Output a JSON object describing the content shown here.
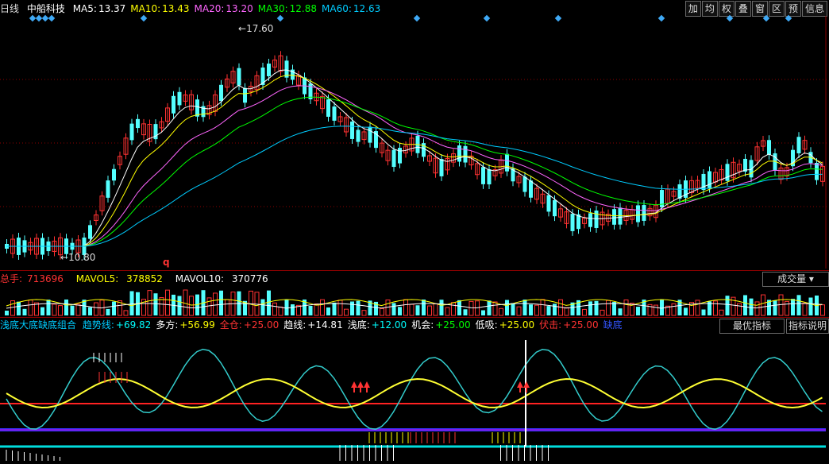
{
  "header": {
    "period": "日线",
    "stock_name": "中船科技",
    "ma": [
      {
        "label": "MA5:",
        "value": "13.37",
        "color": "#ffffff"
      },
      {
        "label": "MA10:",
        "value": "13.43",
        "color": "#ffff00"
      },
      {
        "label": "MA20:",
        "value": "13.20",
        "color": "#ff66ff"
      },
      {
        "label": "MA30:",
        "value": "12.88",
        "color": "#00ff00"
      },
      {
        "label": "MA60:",
        "value": "12.63",
        "color": "#00ccff"
      }
    ]
  },
  "toolbar": [
    "加",
    "均",
    "权",
    "叠",
    "窗",
    "区",
    "预",
    "信息"
  ],
  "price_chart": {
    "high_label": "17.60",
    "low_label": "10.80",
    "marker": "q"
  },
  "volume": {
    "total_label": "总手:",
    "total_value": "713696",
    "mavol5_label": "MAVOL5:",
    "mavol5_value": "378852",
    "mavol10_label": "MAVOL10:",
    "mavol10_value": "370776",
    "selector": "成交量"
  },
  "indicator": {
    "name": "浅底大底缺底组合",
    "items": [
      {
        "label": "趋势线:",
        "value": "+69.82",
        "color": "#00ffff"
      },
      {
        "label": "多方:",
        "value": "+56.99",
        "color": "#ffff00"
      },
      {
        "label": "全仓:",
        "value": "+25.00",
        "color": "#ff3333"
      },
      {
        "label": "趋线:",
        "value": "+14.81",
        "color": "#ffffff"
      },
      {
        "label": "浅底:",
        "value": "+12.00",
        "color": "#00ffff"
      },
      {
        "label": "机会:",
        "value": "+25.00",
        "color": "#00ff00"
      },
      {
        "label": "低吸:",
        "value": "+25.00",
        "color": "#ffff00"
      },
      {
        "label": "伏击:",
        "value": "+25.00",
        "color": "#ff3333"
      }
    ],
    "trailing": "缺底",
    "best_button": "最优指标",
    "explain_button": "指标说明"
  },
  "colors": {
    "up": "#ff3232",
    "down": "#54ffff",
    "background": "#000000",
    "grid": "#8b0000"
  }
}
